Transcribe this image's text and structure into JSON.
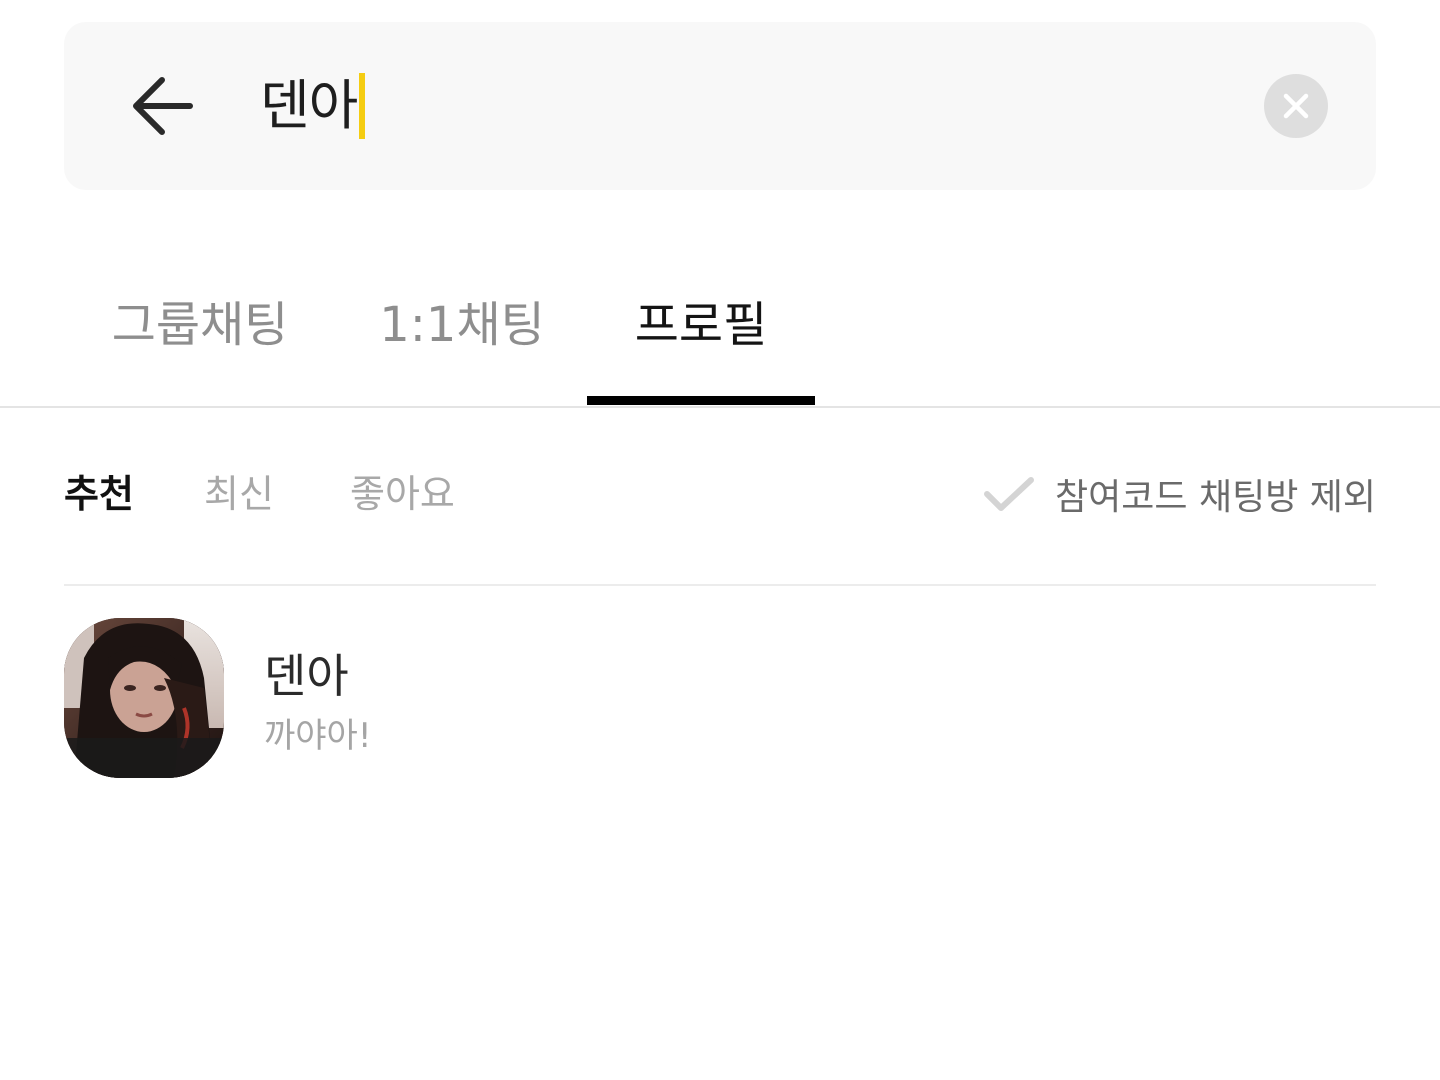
{
  "search": {
    "query": "덴아",
    "caret_color": "#f5cd12"
  },
  "icons": {
    "back": "arrow-left-icon",
    "clear": "close-circle-icon",
    "check": "check-icon"
  },
  "tabs": [
    {
      "label": "그룹채팅",
      "active": false
    },
    {
      "label": "1:1채팅",
      "active": false
    },
    {
      "label": "프로필",
      "active": true
    }
  ],
  "filters": {
    "sort_options": [
      {
        "label": "추천",
        "active": true
      },
      {
        "label": "최신",
        "active": false
      },
      {
        "label": "좋아요",
        "active": false
      }
    ],
    "exclude_label": "참여코드 채팅방 제외",
    "exclude_checked": false
  },
  "results": [
    {
      "name": "덴아",
      "status": "까야아!"
    }
  ]
}
